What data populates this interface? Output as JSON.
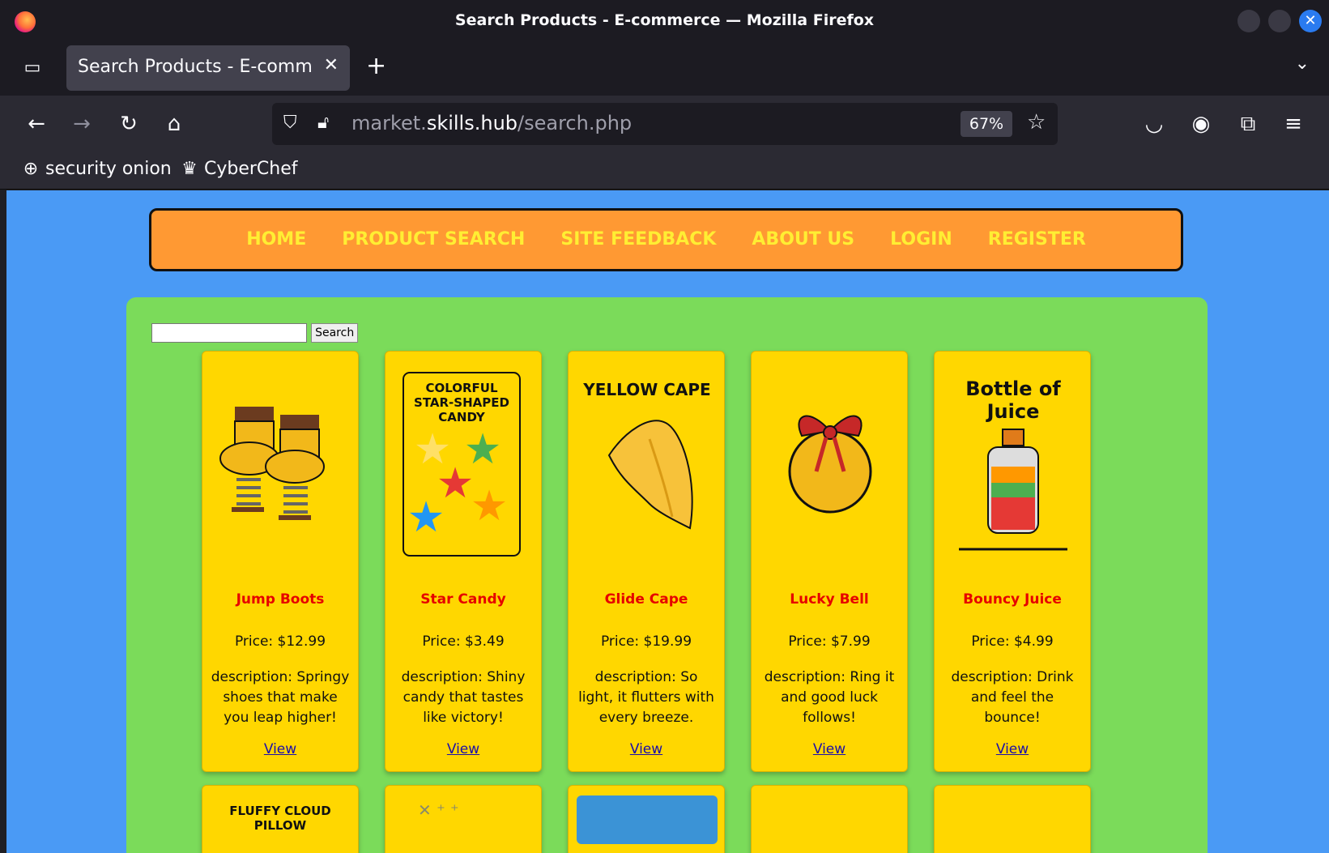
{
  "window": {
    "title": "Search Products - E-commerce — Mozilla Firefox"
  },
  "tab": {
    "label": "Search Products - E-commerce",
    "close": "✕"
  },
  "new_tab": "+",
  "address": {
    "url_prefix": "market.",
    "url_domain": "skills.hub",
    "url_path": "/search.php",
    "zoom": "67%"
  },
  "bookmarks": [
    {
      "label": "security onion"
    },
    {
      "label": "CyberChef"
    }
  ],
  "site_nav": [
    "HOME",
    "PRODUCT SEARCH",
    "SITE FEEDBACK",
    "ABOUT US",
    "LOGIN",
    "REGISTER"
  ],
  "search": {
    "value": "",
    "button": "Search"
  },
  "products": [
    {
      "name": "Jump Boots",
      "price": "Price: $12.99",
      "description": "description: Springy shoes that make you leap higher!",
      "view": "View",
      "image_text": ""
    },
    {
      "name": "Star Candy",
      "price": "Price: $3.49",
      "description": "description: Shiny candy that tastes like victory!",
      "view": "View",
      "image_text": "COLORFUL STAR-SHAPED CANDY"
    },
    {
      "name": "Glide Cape",
      "price": "Price: $19.99",
      "description": "description: So light, it flutters with every breeze.",
      "view": "View",
      "image_text": "YELLOW CAPE"
    },
    {
      "name": "Lucky Bell",
      "price": "Price: $7.99",
      "description": "description: Ring it and good luck follows!",
      "view": "View",
      "image_text": ""
    },
    {
      "name": "Bouncy Juice",
      "price": "Price: $4.99",
      "description": "description: Drink and feel the bounce!",
      "view": "View",
      "image_text": "Bottle of Juice"
    }
  ],
  "partial_row": [
    {
      "image_text": "FLUFFY CLOUD PILLOW"
    }
  ],
  "colors": {
    "page_bg": "#4a9af5",
    "nav_bg": "#ff9933",
    "nav_text": "#ffee33",
    "content_bg": "#7bdb5a",
    "card_bg": "#ffd700",
    "product_name": "#e60000"
  }
}
